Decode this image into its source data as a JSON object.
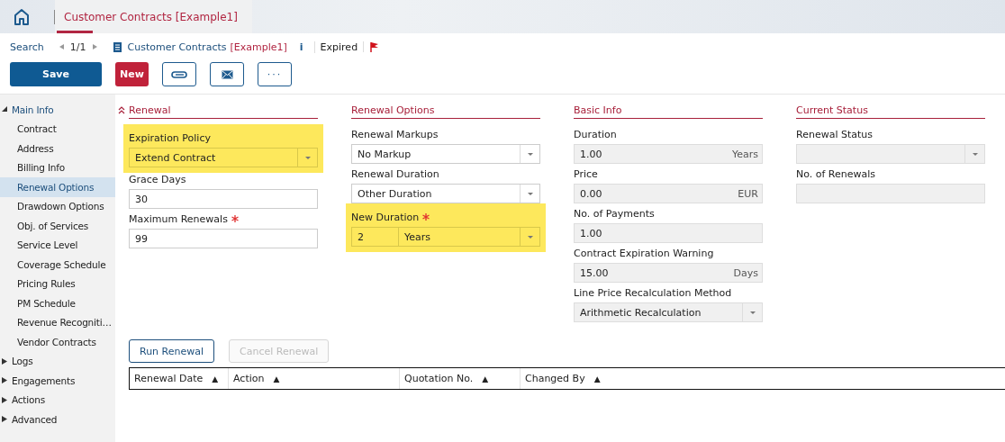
{
  "header": {
    "tab": {
      "label": "Customer Contracts [Example1]",
      "selected": true
    }
  },
  "breadcrumb": {
    "search": "Search",
    "pager": "1/1",
    "record_name": "Customer Contracts",
    "record_id": "[Example1]",
    "info": "i",
    "status": "Expired"
  },
  "toolbar": [
    {
      "kind": "primary",
      "label": "Save"
    },
    {
      "kind": "danger",
      "label": "New"
    },
    {
      "kind": "attach"
    },
    {
      "kind": "mail"
    },
    {
      "kind": "text",
      "label": "···"
    }
  ],
  "sidebar": {
    "items": [
      {
        "label": "Main Info",
        "expanded": true,
        "children": [
          {
            "label": "Contract",
            "selected": false
          },
          {
            "label": "Address",
            "selected": false
          },
          {
            "label": "Billing Info",
            "selected": false
          },
          {
            "label": "Renewal Options",
            "selected": true
          },
          {
            "label": "Drawdown Options",
            "selected": false
          },
          {
            "label": "Obj. of Services",
            "selected": false
          },
          {
            "label": "Service Level",
            "selected": false
          },
          {
            "label": "Coverage Schedule",
            "selected": false
          },
          {
            "label": "Pricing Rules",
            "selected": false
          },
          {
            "label": "PM Schedule",
            "selected": false
          },
          {
            "label": "Revenue Recogniti…",
            "selected": false
          },
          {
            "label": "Vendor Contracts",
            "selected": false
          }
        ]
      },
      {
        "label": "Logs",
        "expanded": false
      },
      {
        "label": "Engagements",
        "expanded": false
      },
      {
        "label": "Actions",
        "expanded": false
      },
      {
        "label": "Advanced",
        "expanded": false
      }
    ]
  },
  "sections": [
    {
      "title": "Renewal",
      "collapsible": true,
      "fields": [
        {
          "label": "Expiration Policy",
          "kind": "select",
          "value": "Extend Contract",
          "required": false,
          "highlighted": true,
          "readonly": false
        },
        {
          "label": "Grace Days",
          "kind": "text",
          "value": "30",
          "required": false,
          "highlighted": false,
          "readonly": false
        },
        {
          "label": "Maximum Renewals",
          "kind": "text",
          "value": "99",
          "required": true,
          "highlighted": false,
          "readonly": false
        }
      ]
    },
    {
      "title": "Renewal Options",
      "collapsible": false,
      "fields": [
        {
          "label": "Renewal Markups",
          "kind": "select",
          "value": "No Markup",
          "required": false,
          "highlighted": false,
          "readonly": false
        },
        {
          "label": "Renewal Duration",
          "kind": "select",
          "value": "Other Duration",
          "required": false,
          "highlighted": false,
          "readonly": false
        },
        {
          "label": "New Duration",
          "kind": "combo",
          "value": "2",
          "unit": "Years",
          "required": true,
          "highlighted": true,
          "readonly": false
        }
      ]
    },
    {
      "title": "Basic Info",
      "collapsible": false,
      "fields": [
        {
          "label": "Duration",
          "kind": "text",
          "value": "1.00",
          "unit": "Years",
          "required": false,
          "highlighted": false,
          "readonly": true
        },
        {
          "label": "Price",
          "kind": "text",
          "value": "0.00",
          "unit": "EUR",
          "required": false,
          "highlighted": false,
          "readonly": true
        },
        {
          "label": "No. of Payments",
          "kind": "text",
          "value": "1.00",
          "required": false,
          "highlighted": false,
          "readonly": true
        },
        {
          "label": "Contract Expiration Warning",
          "kind": "text",
          "value": "15.00",
          "unit": "Days",
          "required": false,
          "highlighted": false,
          "readonly": true
        },
        {
          "label": "Line Price Recalculation Method",
          "kind": "select",
          "value": "Arithmetic Recalculation",
          "required": false,
          "highlighted": false,
          "readonly": true
        }
      ]
    },
    {
      "title": "Current Status",
      "collapsible": false,
      "fields": [
        {
          "label": "Renewal Status",
          "kind": "select",
          "required": false,
          "highlighted": false,
          "readonly": true
        },
        {
          "label": "No. of Renewals",
          "kind": "text",
          "required": false,
          "highlighted": false,
          "readonly": true
        }
      ]
    }
  ],
  "actions": [
    {
      "label": "Run Renewal",
      "disabled": false
    },
    {
      "label": "Cancel Renewal",
      "disabled": true
    }
  ],
  "table": {
    "columns": [
      {
        "label": "Renewal Date",
        "sort": "▲"
      },
      {
        "label": "Action",
        "sort": "▲"
      },
      {
        "label": "Quotation No.",
        "sort": "▲"
      },
      {
        "label": "Changed By",
        "sort": "▲"
      }
    ]
  }
}
